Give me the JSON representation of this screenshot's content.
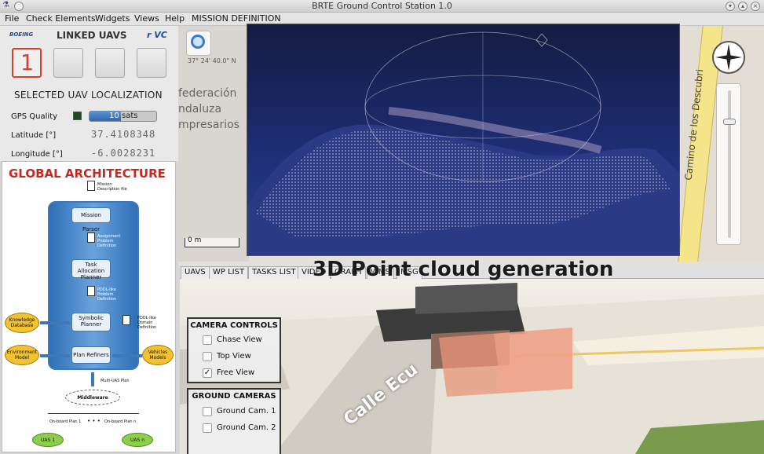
{
  "window": {
    "title": "BRTE Ground Control Station 1.0"
  },
  "menu": [
    "File",
    "Check Elements",
    "Widgets",
    "Views",
    "Help",
    "MISSION DEFINITION"
  ],
  "left_panel": {
    "logo_left": "BOEING",
    "linked_title": "LINKED UAVS",
    "logo_right": "r VC",
    "uav_selected": "1",
    "localization_title": "SELECTED UAV LOCALIZATION",
    "gps_label": "GPS Quality",
    "gps_value": "10",
    "gps_unit": "sats",
    "lat_label": "Latitude [°]",
    "lat_value": "37.4108348",
    "lon_label": "Longitude [°]",
    "lon_value": "-6.0028231"
  },
  "architecture": {
    "title": "GLOBAL ARCHITECTURE",
    "mission_file": "Mission Description file",
    "mission_parser": "Mission Parser",
    "assignment": "Assignment Problem Definition",
    "task_alloc": "Task Allocation Planner",
    "pddl_problem": "PDDL-like Problem Definition",
    "symbolic": "Symbolic Planner",
    "pddl_domain": "PDDL-like Domain Definition",
    "plan_refiners": "Plan Refiners",
    "knowledge": "Knowledge Database",
    "environment": "Environment Model",
    "vehicles": "Vehicles Models",
    "multi_plan": "Multi-UAS Plan",
    "middleware": "Middleware",
    "onboard1": "On-board Plan 1",
    "onboardn": "On-board Plan n",
    "dots": "• • •",
    "uas1": "UAS 1",
    "uasn": "UAS n"
  },
  "map": {
    "coord": "37° 24' 40.0\" N",
    "text1": "federación",
    "text2": "ndaluza",
    "text3": "mpresarios",
    "street": "Camino de los Descubri",
    "scale": "0 m"
  },
  "tabs": [
    "UAVS",
    "WP LIST",
    "TASKS LIST",
    "VIDEO",
    "GRAPH",
    "WMS",
    "MSG"
  ],
  "overlay_title": "3D Point cloud generation",
  "camera_controls": {
    "title": "CAMERA CONTROLS",
    "items": [
      {
        "label": "Chase View",
        "checked": false
      },
      {
        "label": "Top View",
        "checked": false
      },
      {
        "label": "Free View",
        "checked": true
      }
    ]
  },
  "ground_cameras": {
    "title": "GROUND CAMERAS",
    "items": [
      {
        "label": "Ground Cam. 1",
        "checked": false
      },
      {
        "label": "Ground Cam. 2",
        "checked": false
      }
    ]
  },
  "scene": {
    "street_label": "Calle Ecu"
  },
  "colors": {
    "accent": "#d5422b",
    "arch_title": "#c8281e",
    "arch_blue": "#3f78b8",
    "pointcloud_bg": "#1c2a6b"
  }
}
